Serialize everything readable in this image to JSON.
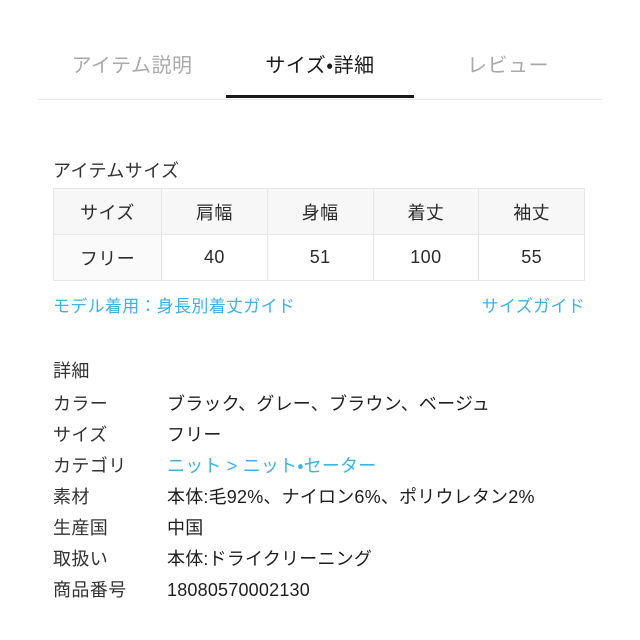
{
  "colors": {
    "link": "#3ab4e8",
    "active_tab": "#1a1a1a",
    "inactive_tab": "#aaaaaa",
    "table_header_bg": "#f7f7f7",
    "border": "#e6e6e6"
  },
  "tabs": [
    {
      "label": "アイテム説明",
      "active": false
    },
    {
      "label": "サイズ・詳細",
      "active": true
    },
    {
      "label": "レビュー",
      "active": false
    }
  ],
  "item_size": {
    "heading": "アイテムサイズ",
    "columns": [
      "サイズ",
      "肩幅",
      "身幅",
      "着丈",
      "袖丈"
    ],
    "rows": [
      [
        "フリー",
        "40",
        "51",
        "100",
        "55"
      ]
    ]
  },
  "guides": {
    "model_guide": "モデル着用：身長別着丈ガイド",
    "size_guide": "サイズガイド"
  },
  "detail": {
    "heading": "詳細",
    "rows": [
      {
        "label": "カラー",
        "value": "ブラック、グレー、ブラウン、ベージュ",
        "is_link": false
      },
      {
        "label": "サイズ",
        "value": "フリー",
        "is_link": false
      },
      {
        "label": "カテゴリ",
        "value": "ニット > ニット・セーター",
        "is_link": true
      },
      {
        "label": "素材",
        "value": "本体:毛92%、ナイロン6%、ポリウレタン2%",
        "is_link": false
      },
      {
        "label": "生産国",
        "value": "中国",
        "is_link": false
      },
      {
        "label": "取扱い",
        "value": "本体:ドライクリーニング",
        "is_link": false
      },
      {
        "label": "商品番号",
        "value": "18080570002130",
        "is_link": false
      }
    ]
  }
}
